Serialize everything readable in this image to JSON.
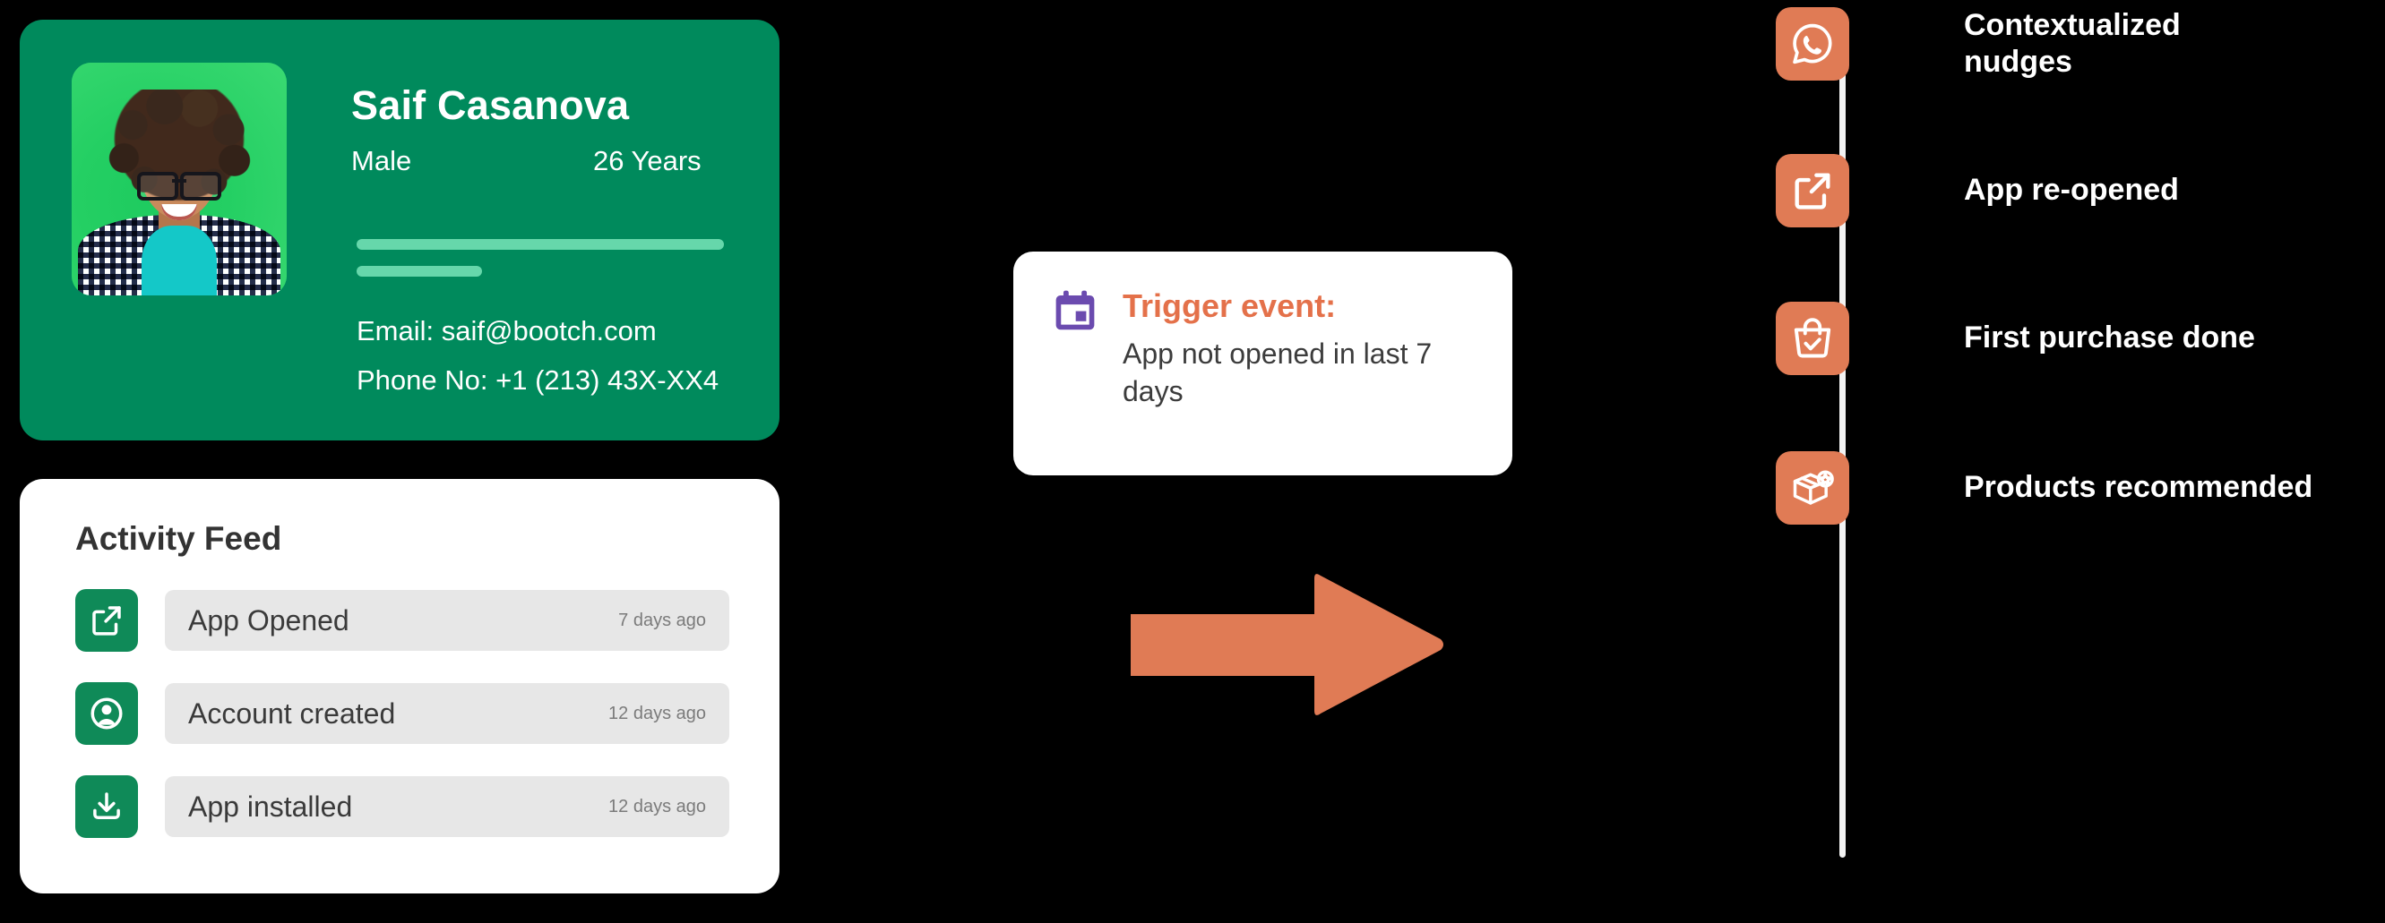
{
  "profile": {
    "name": "Saif Casanova",
    "gender": "Male",
    "age": "26 Years",
    "email": "Email: saif@bootch.com",
    "phone": "Phone No: +1 (213) 43X-XX4",
    "avatar_alt": "user-portrait",
    "card_color": "#008A5C",
    "bar_color": "#66d7ab"
  },
  "activity": {
    "title": "Activity Feed",
    "icon_color": "#0f8a58",
    "rows": [
      {
        "icon": "external-link-icon",
        "label": "App Opened",
        "time": "7 days ago"
      },
      {
        "icon": "account-circle-icon",
        "label": "Account created",
        "time": "12 days ago"
      },
      {
        "icon": "download-icon",
        "label": "App installed",
        "time": "12 days ago"
      }
    ]
  },
  "trigger": {
    "icon": "calendar-icon",
    "icon_color": "#6B4BAF",
    "heading": "Trigger event:",
    "heading_color": "#E4714A",
    "description": "App not opened in last 7 days"
  },
  "arrow": {
    "name": "right-arrow",
    "color": "#E07B55"
  },
  "timeline": {
    "badge_color": "#E07B55",
    "line_color": "#f2f2f2",
    "items": [
      {
        "icon": "whatsapp-icon",
        "label": "Contextualized\nnudges"
      },
      {
        "icon": "external-link-icon",
        "label": "App re-opened"
      },
      {
        "icon": "shopping-bag-check-icon",
        "label": "First purchase done"
      },
      {
        "icon": "package-star-icon",
        "label": "Products recommended"
      }
    ]
  }
}
